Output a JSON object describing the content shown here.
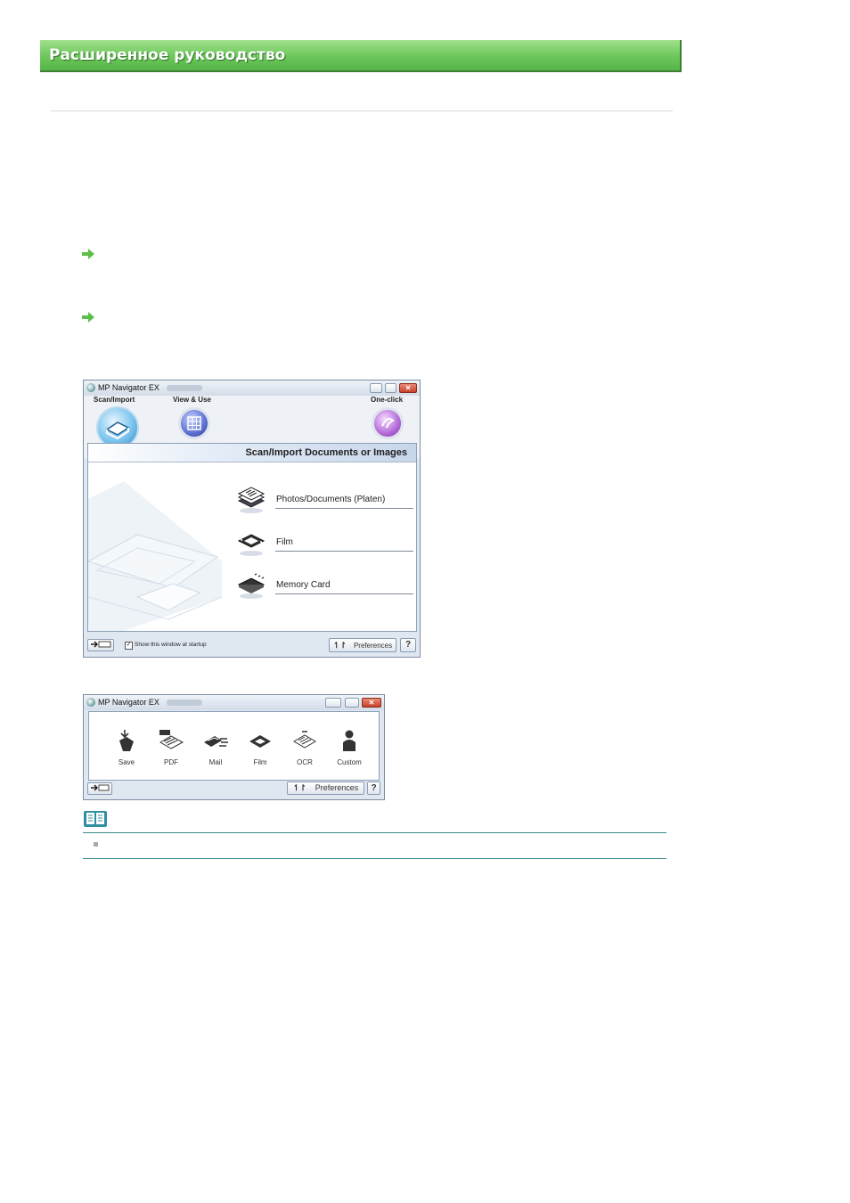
{
  "header": {
    "title": "Расширенное руководство"
  },
  "main_window": {
    "title": "MP Navigator EX",
    "tabs": [
      {
        "label": "Scan/Import"
      },
      {
        "label": "View & Use"
      },
      {
        "label": "One-click"
      }
    ],
    "panel_title": "Scan/Import Documents or Images",
    "items": [
      {
        "label": "Photos/Documents (Platen)",
        "icon": "photos-documents-icon"
      },
      {
        "label": "Film",
        "icon": "film-icon"
      },
      {
        "label": "Memory Card",
        "icon": "memory-card-icon"
      }
    ],
    "startup_checkbox": {
      "label": "Show this window at startup",
      "checked": true
    },
    "preferences_label": "Preferences",
    "help_label": "?"
  },
  "mini_window": {
    "title": "MP Navigator EX",
    "items": [
      {
        "label": "Save",
        "icon": "save-icon"
      },
      {
        "label": "PDF",
        "icon": "pdf-icon"
      },
      {
        "label": "Mail",
        "icon": "mail-icon"
      },
      {
        "label": "Film",
        "icon": "film-icon"
      },
      {
        "label": "OCR",
        "icon": "ocr-icon"
      },
      {
        "label": "Custom",
        "icon": "custom-icon"
      }
    ],
    "preferences_label": "Preferences",
    "help_label": "?"
  },
  "colors": {
    "banner_green": "#6cc75a",
    "accent_blue": "#3a8fc8",
    "note_teal": "#3a8a8a"
  }
}
